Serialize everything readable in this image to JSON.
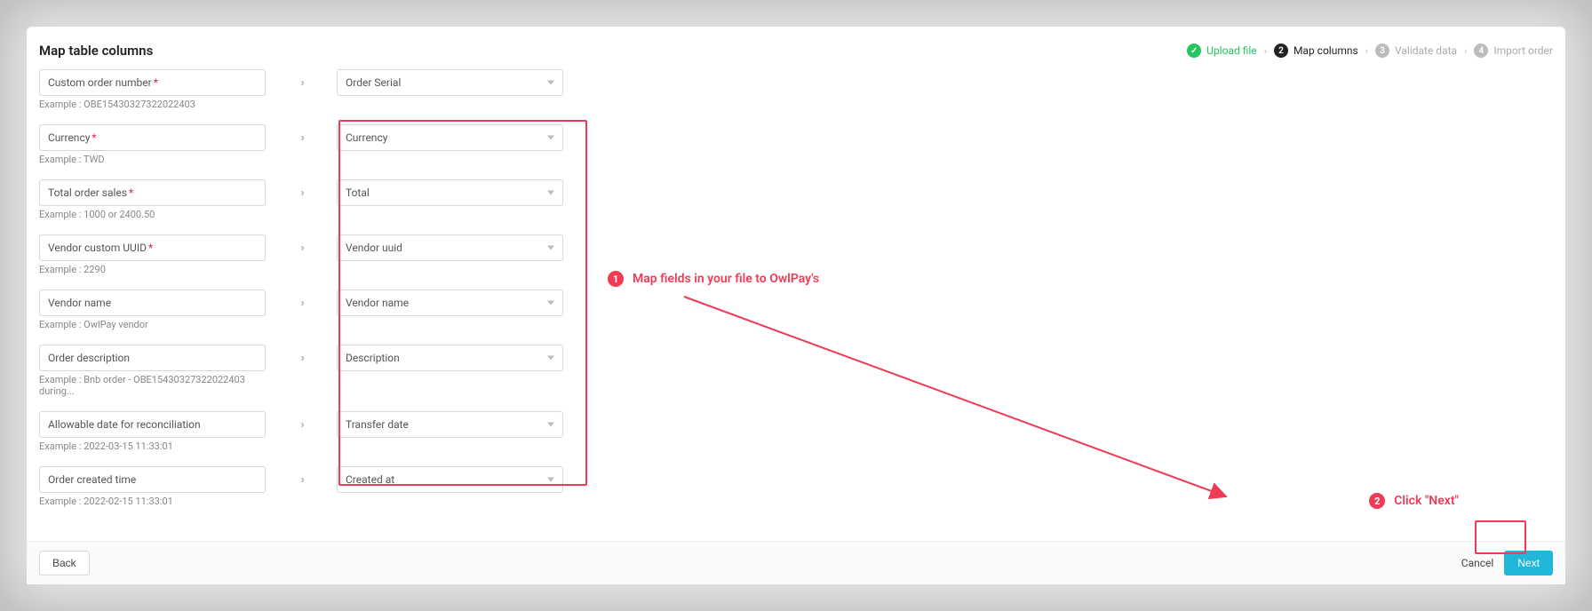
{
  "title": "Map table columns",
  "steps": [
    {
      "num": "✓",
      "label": "Upload file",
      "state": "done"
    },
    {
      "num": "2",
      "label": "Map columns",
      "state": "current"
    },
    {
      "num": "3",
      "label": "Validate data",
      "state": "future"
    },
    {
      "num": "4",
      "label": "Import order",
      "state": "future"
    }
  ],
  "rows": [
    {
      "label": "Custom order number",
      "required": true,
      "example": "Example : OBE15430327322022403",
      "mapped": "Order Serial"
    },
    {
      "label": "Currency",
      "required": true,
      "example": "Example : TWD",
      "mapped": "Currency"
    },
    {
      "label": "Total order sales",
      "required": true,
      "example": "Example : 1000 or 2400.50",
      "mapped": "Total"
    },
    {
      "label": "Vendor custom UUID",
      "required": true,
      "example": "Example : 2290",
      "mapped": "Vendor uuid"
    },
    {
      "label": "Vendor name",
      "required": false,
      "example": "Example : OwlPay vendor",
      "mapped": "Vendor name"
    },
    {
      "label": "Order description",
      "required": false,
      "example": "Example : Bnb order - OBE15430327322022403 during...",
      "mapped": "Description"
    },
    {
      "label": "Allowable date for reconciliation",
      "required": false,
      "example": "Example : 2022-03-15 11:33:01",
      "mapped": "Transfer date"
    },
    {
      "label": "Order created time",
      "required": false,
      "example": "Example : 2022-02-15 11:33:01",
      "mapped": "Created at"
    }
  ],
  "arrow_glyph": "››",
  "annotations": {
    "a1": {
      "num": "1",
      "text": "Map fields in your file to OwlPay's"
    },
    "a2": {
      "num": "2",
      "text": "Click \"Next\""
    }
  },
  "footer": {
    "back": "Back",
    "cancel": "Cancel",
    "next": "Next"
  }
}
